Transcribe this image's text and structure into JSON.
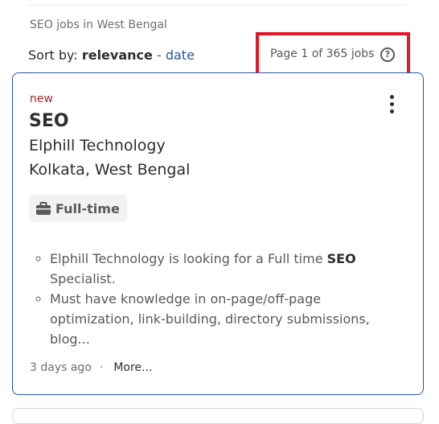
{
  "results": {
    "heading": "SEO jobs in West Bengal",
    "sort": {
      "label": "Sort by:",
      "active": "relevance",
      "separator": "-",
      "alternate": "date"
    },
    "page_count": "Page 1 of 365 jobs",
    "help_icon": "?"
  },
  "job": {
    "badge": "new",
    "title": "SEO",
    "company": "Elphill Technology",
    "location": "Kolkata, West Bengal",
    "tag": {
      "icon": "briefcase-icon",
      "label": "Full-time"
    },
    "snippet": {
      "item1_text": "Elphill Technology is looking for a Full time ",
      "item1_bold": "SEO",
      "item1_tail": " Specialist.",
      "item2_text": "Must have knowledge in on-page/off-page optimization, link-building, directory submissions, blog..."
    },
    "posted": "3 days ago",
    "dot": "·",
    "more": "More..."
  },
  "colors": {
    "link": "#2557a7",
    "new_badge": "#a9252b",
    "highlight_box": "#e0182a",
    "card_border": "#2557a7"
  }
}
